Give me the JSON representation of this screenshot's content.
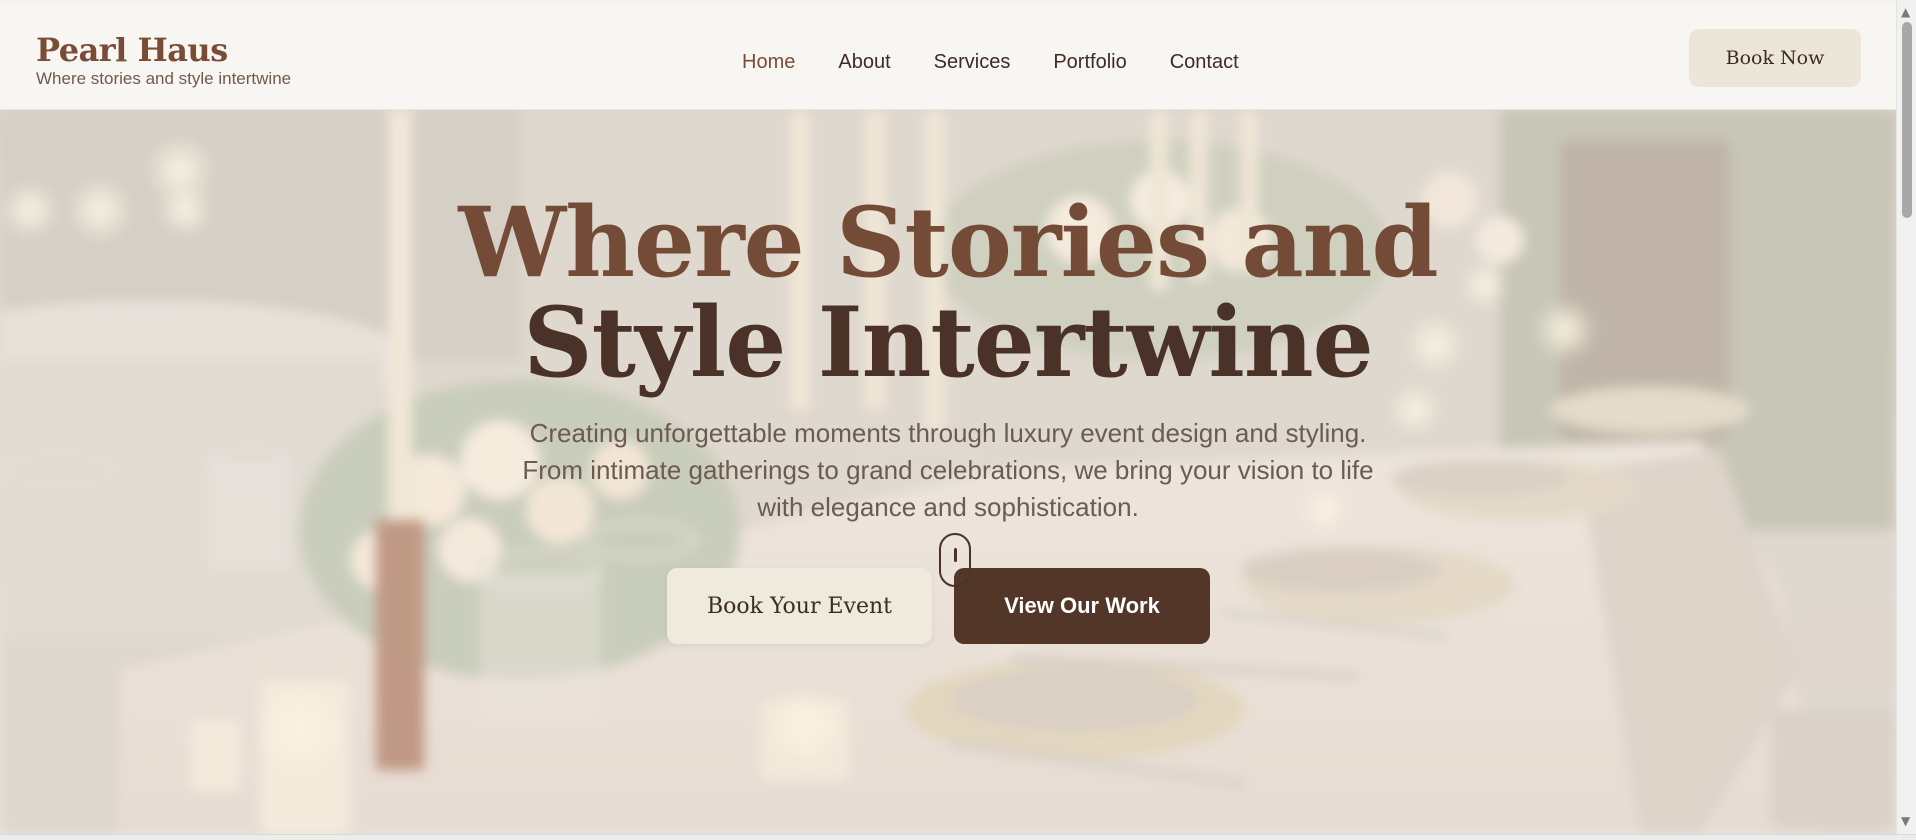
{
  "brand": {
    "name": "Pearl Haus",
    "tagline": "Where stories and style intertwine"
  },
  "nav": {
    "items": [
      {
        "label": "Home",
        "active": true
      },
      {
        "label": "About",
        "active": false
      },
      {
        "label": "Services",
        "active": false
      },
      {
        "label": "Portfolio",
        "active": false
      },
      {
        "label": "Contact",
        "active": false
      }
    ],
    "cta_label": "Book Now"
  },
  "hero": {
    "title_line1": "Where Stories and",
    "title_line2": "Style Intertwine",
    "subtitle": "Creating unforgettable moments through luxury event design and styling. From intimate gatherings to grand celebrations, we bring your vision to life with elegance and sophistication.",
    "primary_button": "Book Your Event",
    "secondary_button": "View Our Work"
  },
  "colors": {
    "brand_brown": "#7a4c36",
    "dark_brown": "#523728",
    "cream": "#ece6d9"
  },
  "icons": {
    "scroll_indicator": "mouse-scroll-icon",
    "scroll_up": "chevron-up-icon",
    "scroll_down": "chevron-down-icon"
  }
}
